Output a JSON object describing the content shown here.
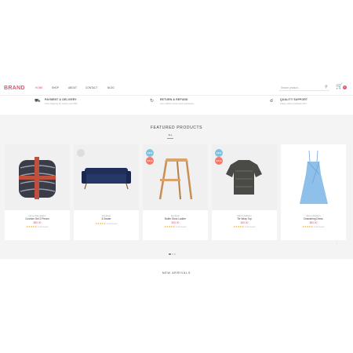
{
  "header": {
    "brand": "BRAND",
    "nav": [
      "HOME",
      "SHOP",
      "ABOUT",
      "CONTACT",
      "BLOG"
    ],
    "search_placeholder": "Search product...",
    "cart_count": "0"
  },
  "features": [
    {
      "title": "PAYMENT & DELIVERY",
      "subtitle": "Free shipping for orders over $50"
    },
    {
      "title": "RETURN & REFUND",
      "subtitle": "Free 100% money back guarantee"
    },
    {
      "title": "QUALITY SUPPORT",
      "subtitle": "Alway online feedback 24/7"
    }
  ],
  "products_section": {
    "title": "FEATURED PRODUCTS",
    "filter": "ALL"
  },
  "products": [
    {
      "category": "Home Decoration",
      "name": "Cushion Set 3 Pieces",
      "price": "$89.00",
      "reviews": "0 Reviews",
      "badge": ""
    },
    {
      "category": "Furniture",
      "name": "3-Seater",
      "price": "",
      "reviews": "0 Reviews",
      "badge": "NEW"
    },
    {
      "category": "Furniture",
      "name": "Butler Stool Ladder",
      "price": "$25.00",
      "reviews": "0 Reviews",
      "badge": "SALE"
    },
    {
      "category": "Men's Fashion",
      "name": "Tie Wrap Top",
      "price": "$45.00",
      "reviews": "0 Reviews",
      "badge": "SALE"
    },
    {
      "category": "Men's Fashion",
      "name": "Drawstring Dress",
      "price": "$84.00",
      "reviews": "0 Reviews",
      "badge": ""
    }
  ],
  "new_arrivals": "NEW ARRIVALS",
  "colors": {
    "accent": "#e8506a",
    "section_bg": "#f4f4f4",
    "star": "#f2a900",
    "badge_new": "#7ec4e0",
    "badge_sale": "#f47a6b"
  }
}
